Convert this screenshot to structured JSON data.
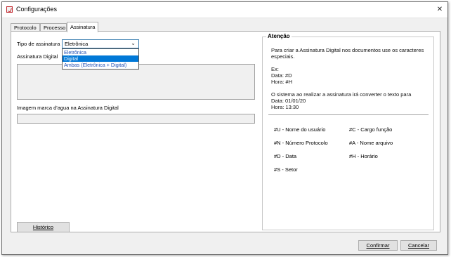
{
  "window": {
    "title": "Configurações",
    "close_glyph": "✕"
  },
  "tabs": [
    {
      "label": "Protocolo"
    },
    {
      "label": "Processo"
    },
    {
      "label": "Assinatura"
    }
  ],
  "form": {
    "signature_type_label": "Tipo de assinatura",
    "signature_type_value": "Eletrônica",
    "options": [
      "Eletrônica",
      "Digital",
      "Ambas (Eletrônica + Digital)"
    ],
    "digital_signature_label": "Assinatura Digital",
    "watermark_label": "Imagem marca d'agua na Assinatura Digital",
    "history_button": "Histórico"
  },
  "attention": {
    "title": "Atenção",
    "lines": [
      "Para criar a Assinatura Digital nos documentos use os caracteres",
      "especiais.",
      "Ex:",
      "Data: #D",
      "Hora: #H",
      "O sistema ao realizar a assinatura irá converter o texto para",
      "Data: 01/01/20",
      "Hora: 13:30"
    ],
    "codes": [
      "#U - Nome do usuário",
      "#C - Cargo função",
      "#N - Número Protocolo",
      "#A - Nome arquivo",
      "#D - Data",
      "#H - Horário",
      "#S - Setor"
    ]
  },
  "footer": {
    "confirm_button": "Confirmar",
    "cancel_button": "Cancelar"
  },
  "icons": {
    "app": "app-icon",
    "close": "close-icon",
    "dropdown": "chevron-down-icon"
  },
  "colors": {
    "selection": "#0078d7",
    "focus_border": "#3c7fb1",
    "option_text": "#1f4fb4"
  }
}
